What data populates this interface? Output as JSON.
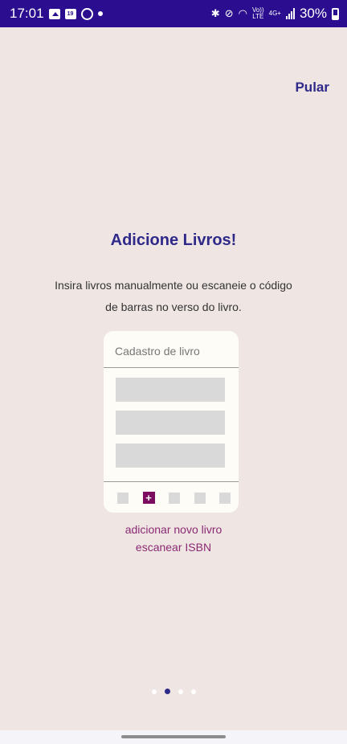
{
  "status_bar": {
    "time": "17:01",
    "network_small_top": "Vo))",
    "network_small_bottom": "LTE",
    "network_type": "4G+",
    "battery_percent": "30%"
  },
  "onboarding": {
    "skip_label": "Pular",
    "title": "Adicione Livros!",
    "description": "Insira livros manualmente ou escaneie o código de barras no verso do livro.",
    "mockup": {
      "header": "Cadastro de livro",
      "plus_symbol": "+"
    },
    "caption_line1": "adicionar novo livro",
    "caption_line2": "escanear ISBN",
    "pagination": {
      "total": 4,
      "current": 2
    }
  },
  "colors": {
    "status_bar_bg": "#2a0e8f",
    "background": "#efe5e3",
    "accent": "#2f2a8a",
    "caption": "#8b2a73",
    "plus_button": "#7b0c5f"
  }
}
